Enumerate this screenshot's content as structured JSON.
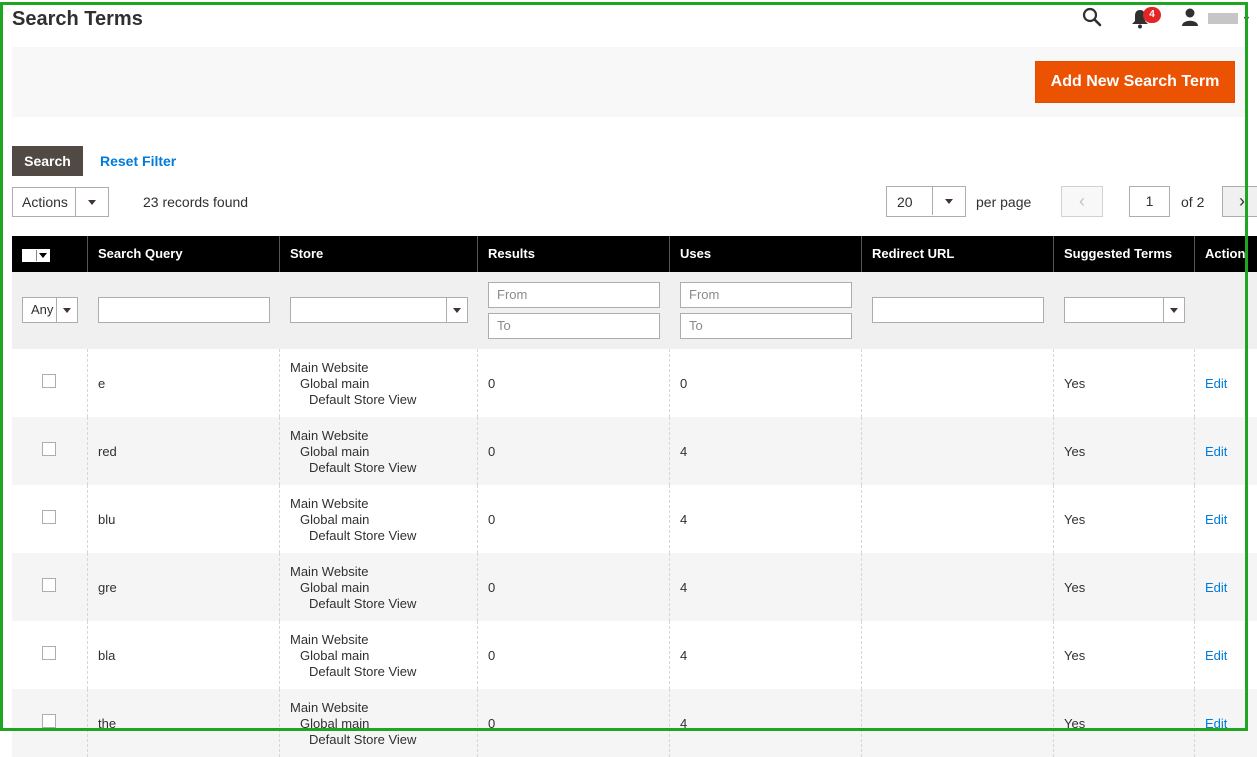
{
  "header": {
    "title": "Search Terms",
    "notifications_count": "4"
  },
  "page_actions": {
    "add_button": "Add New Search Term"
  },
  "filters_bar": {
    "search_button": "Search",
    "reset_filter": "Reset Filter"
  },
  "toolbar": {
    "actions_label": "Actions",
    "records_found": "23 records found",
    "per_page_value": "20",
    "per_page_label": "per page",
    "current_page": "1",
    "of_pages": "of 2"
  },
  "columns": {
    "search_query": "Search Query",
    "store": "Store",
    "results": "Results",
    "uses": "Uses",
    "redirect_url": "Redirect URL",
    "suggested_terms": "Suggested Terms",
    "action": "Action"
  },
  "filter_row": {
    "any_option": "Any",
    "from_placeholder": "From",
    "to_placeholder": "To"
  },
  "rows": [
    {
      "query": "e",
      "store1": "Main Website",
      "store2": "Global main",
      "store3": "Default Store View",
      "results": "0",
      "uses": "0",
      "redirect": "",
      "suggested": "Yes",
      "action": "Edit"
    },
    {
      "query": "red",
      "store1": "Main Website",
      "store2": "Global main",
      "store3": "Default Store View",
      "results": "0",
      "uses": "4",
      "redirect": "",
      "suggested": "Yes",
      "action": "Edit"
    },
    {
      "query": "blu",
      "store1": "Main Website",
      "store2": "Global main",
      "store3": "Default Store View",
      "results": "0",
      "uses": "4",
      "redirect": "",
      "suggested": "Yes",
      "action": "Edit"
    },
    {
      "query": "gre",
      "store1": "Main Website",
      "store2": "Global main",
      "store3": "Default Store View",
      "results": "0",
      "uses": "4",
      "redirect": "",
      "suggested": "Yes",
      "action": "Edit"
    },
    {
      "query": "bla",
      "store1": "Main Website",
      "store2": "Global main",
      "store3": "Default Store View",
      "results": "0",
      "uses": "4",
      "redirect": "",
      "suggested": "Yes",
      "action": "Edit"
    },
    {
      "query": "the",
      "store1": "Main Website",
      "store2": "Global main",
      "store3": "Default Store View",
      "results": "0",
      "uses": "4",
      "redirect": "",
      "suggested": "Yes",
      "action": "Edit"
    }
  ],
  "colors": {
    "accent_orange": "#eb5202",
    "link_blue": "#007bdb",
    "header_black": "#000000",
    "badge_red": "#e22626",
    "highlight_green": "#1fa51f"
  }
}
